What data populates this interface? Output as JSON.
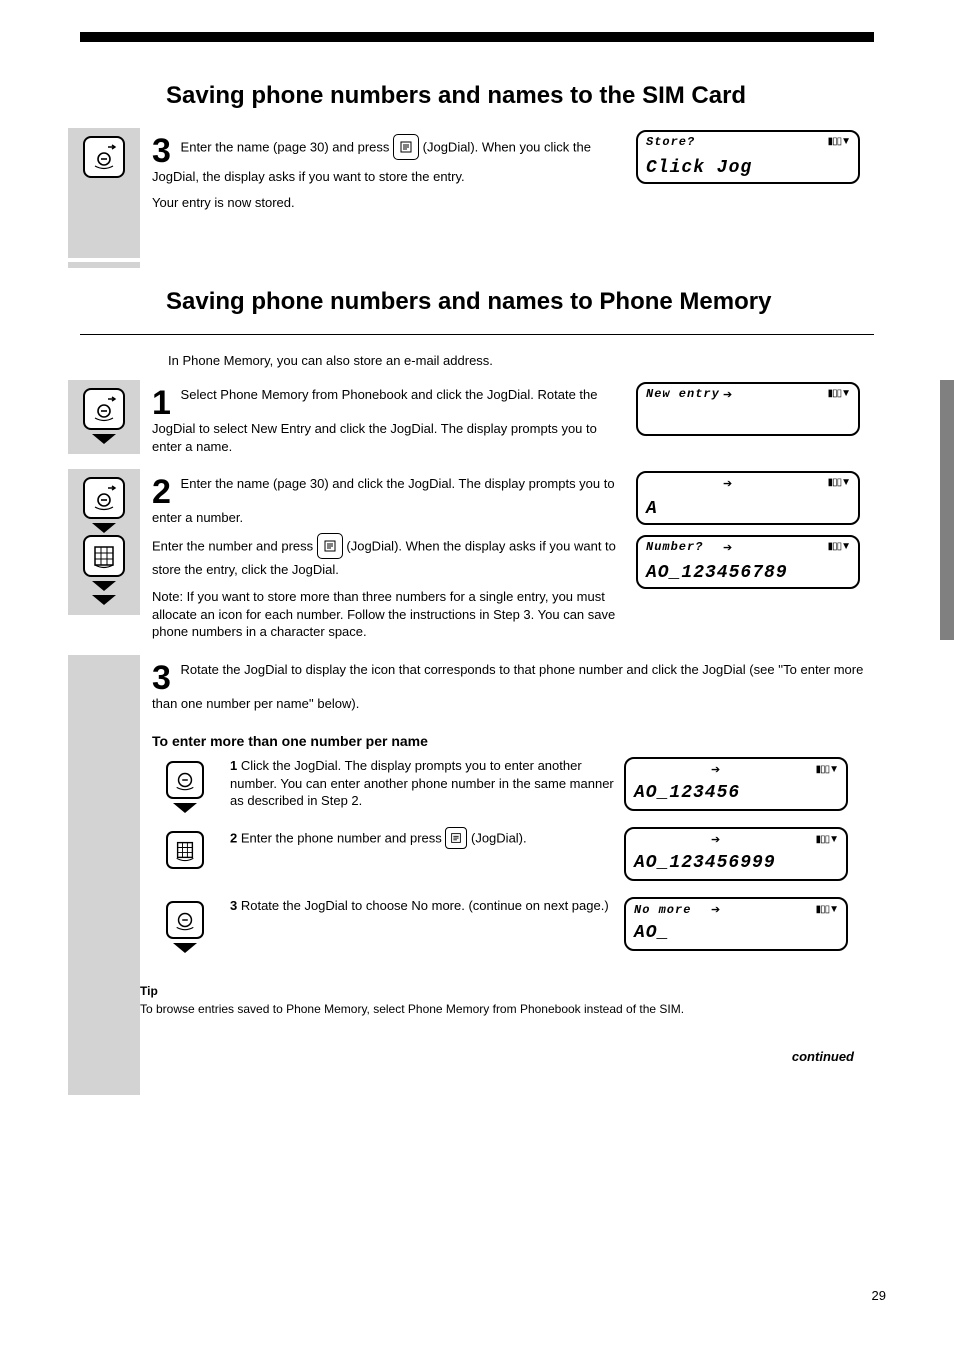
{
  "headings": {
    "h1": "Saving phone numbers and names to the SIM Card",
    "h2": "Saving phone numbers and names to Phone Memory"
  },
  "step3": {
    "num": "3",
    "text_a": "Enter the name (page 30) and press ",
    "text_b": "(JogDial). When you click the JogDial, the display asks if you want to store the entry.",
    "sub": "Your entry is now stored."
  },
  "lcd_store": {
    "line1": "Store?",
    "line2": "Click Jog"
  },
  "pm_intro": "In Phone Memory, you can also store an e-mail address.",
  "pm_step1": {
    "num": "1",
    "text": "Select Phone Memory from Phonebook and click the JogDial. Rotate the JogDial to select New Entry and click the JogDial. The display prompts you to enter a name."
  },
  "lcd_new_entry": {
    "line1": "New entry",
    "line2": ""
  },
  "pm_step2": {
    "num": "2",
    "text_a": "Enter the name (page 30) and click the JogDial. The display prompts you to enter a number.",
    "text_b1": "Enter the number and press ",
    "text_b2": " (JogDial). When the display asks if you want to store the entry, click the JogDial.",
    "note": "Note: If you want to store more than three numbers for a single entry, you must allocate an icon for each number. Follow the instructions in Step 3. You can save phone numbers in a character space."
  },
  "lcd_a": {
    "line1": "",
    "line2": "A"
  },
  "lcd_number": {
    "line1": "Number?",
    "line2": "AO_123456789"
  },
  "pm_step3": {
    "num": "3",
    "text": "Rotate the JogDial to display the icon that corresponds to that phone number and click the JogDial (see ''To enter more than one number per name'' below).",
    "sub_title": "To enter more than one number per name",
    "sub_1": "Click the JogDial. The display prompts you to enter another number. You can enter another phone number in the same manner as described in Step 2.",
    "sub_2_a": "Enter the phone number and press ",
    "sub_2_b": "(JogDial).",
    "sub_3": "Rotate the JogDial to choose No more. (continue on next page.)"
  },
  "lcd_123456": {
    "line1": "",
    "line2": "AO_123456"
  },
  "lcd_123456999": {
    "line1": "",
    "line2": "AO_123456999"
  },
  "lcd_no_more": {
    "line1": "No more",
    "line2": "AO_"
  },
  "tip": {
    "title": "Tip",
    "body": "To browse entries saved to Phone Memory, select Phone Memory from Phonebook instead of the SIM."
  },
  "continued": "continued",
  "page_number": "29",
  "icons": {
    "jog": "jog-dial-icon",
    "jog_right": "jog-push-right-icon",
    "keypad": "keypad-icon",
    "memo": "memo-icon"
  }
}
